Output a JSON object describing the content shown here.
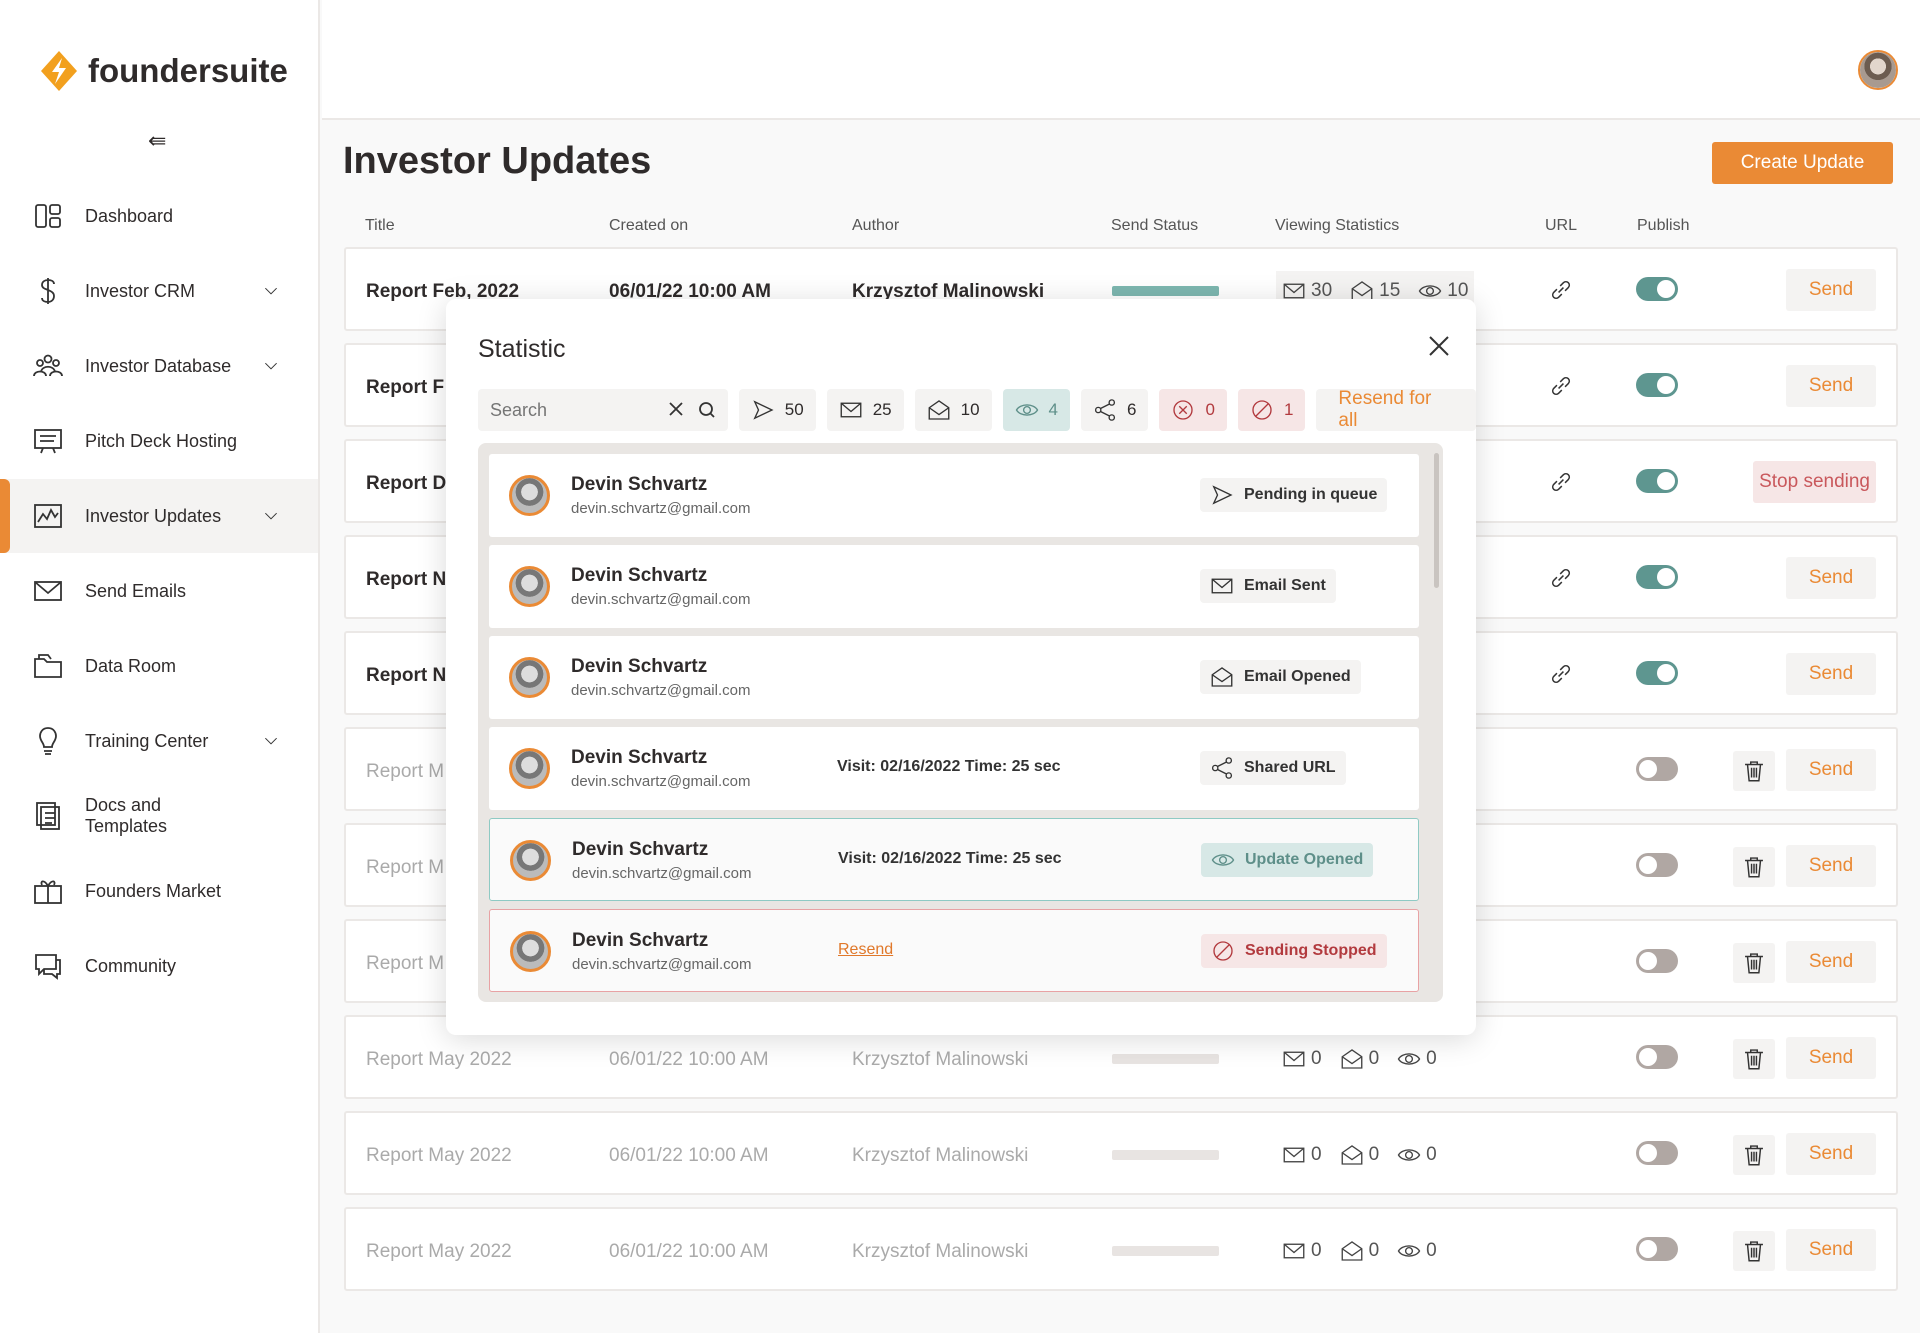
{
  "brand": {
    "name": "foundersuite",
    "accent": "#ea8a35",
    "teal": "#5e9690",
    "danger": "#b23a3e"
  },
  "sidebar": {
    "items": [
      {
        "label": "Dashboard",
        "icon": "dashboard-icon",
        "chevron": false
      },
      {
        "label": "Investor CRM",
        "icon": "dollar-icon",
        "chevron": true
      },
      {
        "label": "Investor Database",
        "icon": "people-icon",
        "chevron": true
      },
      {
        "label": "Pitch Deck Hosting",
        "icon": "presentation-icon",
        "chevron": false
      },
      {
        "label": "Investor Updates",
        "icon": "chart-icon",
        "chevron": true,
        "active": true
      },
      {
        "label": "Send Emails",
        "icon": "mail-icon",
        "chevron": false
      },
      {
        "label": "Data Room",
        "icon": "folder-icon",
        "chevron": false
      },
      {
        "label": "Training Center",
        "icon": "lightbulb-icon",
        "chevron": true
      },
      {
        "label": "Docs and Templates",
        "icon": "documents-icon",
        "chevron": false
      },
      {
        "label": "Founders Market",
        "icon": "gift-icon",
        "chevron": false
      },
      {
        "label": "Community",
        "icon": "chat-icon",
        "chevron": false
      }
    ]
  },
  "page": {
    "title": "Investor Updates",
    "create_label": "Create Update"
  },
  "table": {
    "headers": [
      "Title",
      "Created on",
      "Author",
      "Send Status",
      "Viewing Statistics",
      "URL",
      "Publish"
    ],
    "rows": [
      {
        "title": "Report Feb, 2022",
        "created": "06/01/22 10:00 AM",
        "author": "Krzysztof Malinowski",
        "progress": 100,
        "stats": [
          "30",
          "15",
          "10"
        ],
        "url": true,
        "published": true,
        "action": "Send",
        "highlight": true
      },
      {
        "title": "Report F",
        "published": true,
        "url": true,
        "action": "Send"
      },
      {
        "title": "Report D",
        "published": true,
        "url": true,
        "action": "Stop sending"
      },
      {
        "title": "Report N",
        "published": true,
        "url": true,
        "action": "Send"
      },
      {
        "title": "Report N",
        "published": true,
        "url": true,
        "action": "Send"
      },
      {
        "title": "Report M",
        "published": false,
        "url": false,
        "action": "Send",
        "trash": true
      },
      {
        "title": "Report M",
        "published": false,
        "url": false,
        "action": "Send",
        "trash": true
      },
      {
        "title": "Report M",
        "published": false,
        "url": false,
        "action": "Send",
        "trash": true
      },
      {
        "title": "Report May 2022",
        "created": "06/01/22 10:00 AM",
        "author": "Krzysztof Malinowski",
        "progress": 0,
        "stats": [
          "0",
          "0",
          "0"
        ],
        "published": false,
        "url": false,
        "action": "Send",
        "trash": true
      },
      {
        "title": "Report May 2022",
        "created": "06/01/22 10:00 AM",
        "author": "Krzysztof Malinowski",
        "progress": 0,
        "stats": [
          "0",
          "0",
          "0"
        ],
        "published": false,
        "url": false,
        "action": "Send",
        "trash": true
      },
      {
        "title": "Report May 2022",
        "created": "06/01/22 10:00 AM",
        "author": "Krzysztof Malinowski",
        "progress": 0,
        "stats": [
          "0",
          "0",
          "0"
        ],
        "published": false,
        "url": false,
        "action": "Send",
        "trash": true
      }
    ]
  },
  "modal": {
    "title": "Statistic",
    "search_placeholder": "Search",
    "filters": [
      {
        "icon": "send-icon",
        "count": "50",
        "tone": ""
      },
      {
        "icon": "mail-icon",
        "count": "25",
        "tone": ""
      },
      {
        "icon": "mail-open-icon",
        "count": "10",
        "tone": ""
      },
      {
        "icon": "eye-icon",
        "count": "4",
        "tone": "teal"
      },
      {
        "icon": "share-icon",
        "count": "6",
        "tone": ""
      },
      {
        "icon": "error-circle-icon",
        "count": "0",
        "tone": "red"
      },
      {
        "icon": "blocked-icon",
        "count": "1",
        "tone": "red"
      }
    ],
    "resend_all_label": "Resend for all",
    "items": [
      {
        "name": "Devin Schvartz",
        "email": "devin.schvartz@gmail.com",
        "status": "Pending in queue",
        "icon": "send-icon",
        "tone": ""
      },
      {
        "name": "Devin Schvartz",
        "email": "devin.schvartz@gmail.com",
        "status": "Email Sent",
        "icon": "mail-icon",
        "tone": ""
      },
      {
        "name": "Devin Schvartz",
        "email": "devin.schvartz@gmail.com",
        "status": "Email Opened",
        "icon": "mail-open-icon",
        "tone": ""
      },
      {
        "name": "Devin Schvartz",
        "email": "devin.schvartz@gmail.com",
        "visit": "Visit: 02/16/2022 Time: 25 sec",
        "status": "Shared URL",
        "icon": "share-icon",
        "tone": ""
      },
      {
        "name": "Devin Schvartz",
        "email": "devin.schvartz@gmail.com",
        "visit": "Visit: 02/16/2022 Time: 25 sec",
        "status": "Update Opened",
        "icon": "eye-icon",
        "tone": "teal"
      },
      {
        "name": "Devin Schvartz",
        "email": "devin.schvartz@gmail.com",
        "resend": "Resend",
        "status": "Sending Stopped",
        "icon": "blocked-icon",
        "tone": "red"
      }
    ]
  }
}
